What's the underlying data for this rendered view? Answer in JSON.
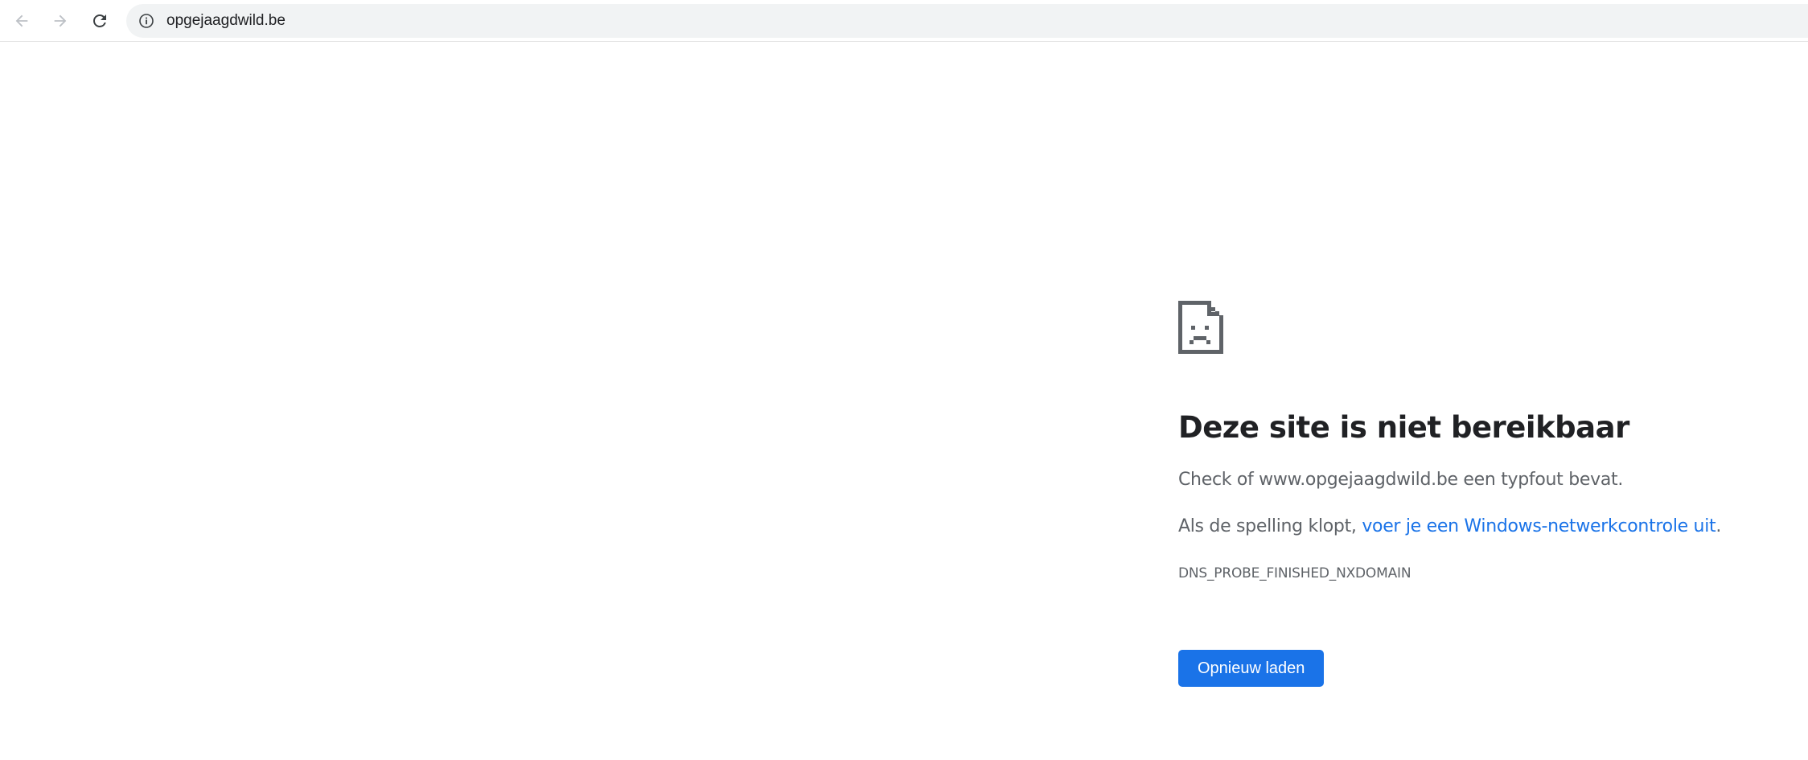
{
  "browser": {
    "address_bar": {
      "url": "opgejaagdwild.be",
      "site_info_icon": "info-circle-icon"
    },
    "nav": {
      "back_icon": "arrow-left-icon",
      "forward_icon": "arrow-right-icon",
      "reload_icon": "reload-icon"
    }
  },
  "error_page": {
    "icon": "sad-document-icon",
    "title": "Deze site is niet bereikbaar",
    "line1": "Check of www.opgejaagdwild.be een typfout bevat.",
    "line2_prefix": "Als de spelling klopt, ",
    "line2_link": "voer je een Windows-netwerkcontrole uit",
    "line2_suffix": ".",
    "error_code": "DNS_PROBE_FINISHED_NXDOMAIN",
    "reload_button": "Opnieuw laden"
  },
  "colors": {
    "accent": "#1a73e8",
    "title_text": "#202124",
    "body_text": "#5f6368",
    "icon_gray": "#5f6368",
    "disabled_icon": "#bdc1c6",
    "omnibox_bg": "#f1f3f4"
  }
}
